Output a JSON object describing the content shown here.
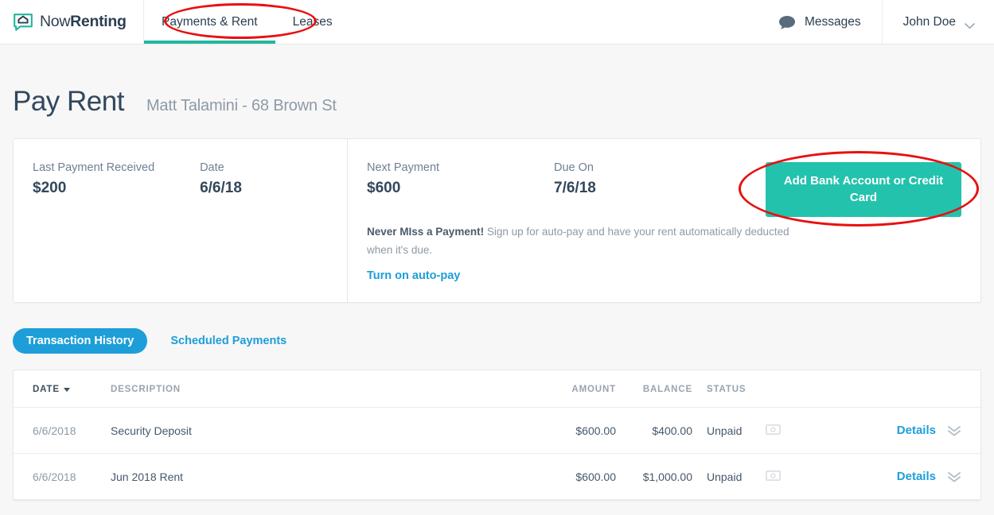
{
  "header": {
    "brand": {
      "name_light": "Now",
      "name_bold": "Renting",
      "logo_icon": "house-chat-bubble-icon"
    },
    "nav": [
      {
        "label": "Payments & Rent",
        "active": true
      },
      {
        "label": "Leases",
        "active": false
      }
    ],
    "messages": {
      "label": "Messages",
      "icon": "speech-bubble-icon"
    },
    "user": {
      "label": "John Doe",
      "icon": "chevron-down-icon"
    }
  },
  "page": {
    "title": "Pay Rent",
    "subtitle": "Matt Talamini - 68 Brown St"
  },
  "summary": {
    "last_payment_label": "Last Payment Received",
    "last_payment_value": "$200",
    "last_payment_date_label": "Date",
    "last_payment_date_value": "6/6/18",
    "next_payment_label": "Next Payment",
    "next_payment_value": "$600",
    "due_on_label": "Due On",
    "due_on_value": "7/6/18",
    "autopay_heading": "Never MIss a Payment!",
    "autopay_body": "Sign up for auto-pay and have your rent automatically deducted when it's due.",
    "autopay_link": "Turn on auto-pay",
    "add_payment_method_button": "Add Bank Account or Credit Card"
  },
  "tabs": [
    {
      "label": "Transaction History",
      "active": true
    },
    {
      "label": "Scheduled Payments",
      "active": false
    }
  ],
  "table": {
    "columns": [
      {
        "key": "date",
        "label": "DATE",
        "sorted": true,
        "sort_icon": "caret-down-icon"
      },
      {
        "key": "description",
        "label": "DESCRIPTION",
        "sorted": false
      },
      {
        "key": "amount",
        "label": "AMOUNT",
        "sorted": false
      },
      {
        "key": "balance",
        "label": "BALANCE",
        "sorted": false
      },
      {
        "key": "status",
        "label": "STATUS",
        "sorted": false
      }
    ],
    "rows": [
      {
        "date": "6/6/2018",
        "description": "Security Deposit",
        "amount": "$600.00",
        "balance": "$400.00",
        "status": "Unpaid",
        "status_icon": "banknote-icon",
        "details_label": "Details",
        "expand_icon": "double-chevron-down-icon"
      },
      {
        "date": "6/6/2018",
        "description": "Jun 2018 Rent",
        "amount": "$600.00",
        "balance": "$1,000.00",
        "status": "Unpaid",
        "status_icon": "banknote-icon",
        "details_label": "Details",
        "expand_icon": "double-chevron-down-icon"
      }
    ]
  },
  "annotations": [
    {
      "name": "highlight-payments-rent-tab",
      "shape": "ellipse",
      "color": "#e81010"
    },
    {
      "name": "highlight-add-payment-method-button",
      "shape": "ellipse",
      "color": "#e81010"
    }
  ],
  "colors": {
    "brand_teal": "#23c2ad",
    "link_blue": "#1d9ed9",
    "text_dark": "#33475b",
    "text_muted": "#8e9aa5",
    "page_bg": "#f7f7f8",
    "annotation_red": "#e81010"
  }
}
